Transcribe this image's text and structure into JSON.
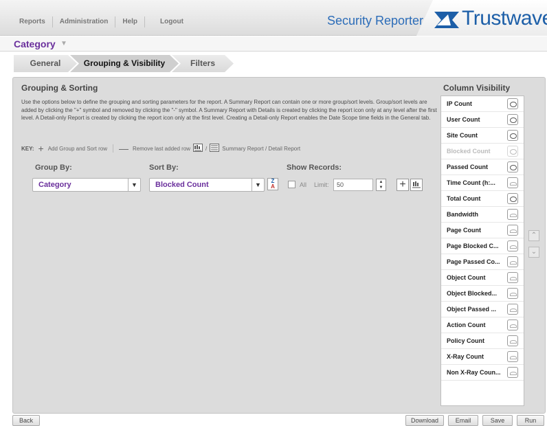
{
  "header": {
    "nav": [
      "Reports",
      "Administration",
      "Help",
      "Logout"
    ],
    "app_title": "Security Reporter",
    "brand": "Trustwave",
    "brand_mark": "®"
  },
  "category": {
    "title": "Category"
  },
  "tabs": [
    {
      "label": "General",
      "active": false
    },
    {
      "label": "Grouping & Visibility",
      "active": true
    },
    {
      "label": "Filters",
      "active": false
    }
  ],
  "grouping": {
    "title": "Grouping & Sorting",
    "description": "Use the options below to define the grouping and sorting parameters for the report. A Summary Report can contain one or more group/sort levels. Group/sort levels are added by clicking the \"+\" symbol and removed by clicking the \"-\" symbol. A Summary Report with Details is created by clicking the report icon only at any level after the first level. A Detail-only Report is created by clicking the report icon only at the first level. Creating a Detail-only Report enables the Date Scope time fields in the General tab.",
    "key_label": "KEY:",
    "key_add": "Add Group and Sort row",
    "key_remove": "Remove last added row",
    "key_slash": "/",
    "key_report": "Summary Report / Detail Report",
    "group_by_label": "Group By:",
    "sort_by_label": "Sort By:",
    "show_records_label": "Show Records:",
    "group_by_value": "Category",
    "sort_by_value": "Blocked Count",
    "all_label": "All",
    "limit_label": "Limit:",
    "limit_value": "50"
  },
  "column_visibility": {
    "title": "Column Visibility",
    "items": [
      {
        "name": "IP Count",
        "visible": true,
        "disabled": false
      },
      {
        "name": "User Count",
        "visible": true,
        "disabled": false
      },
      {
        "name": "Site Count",
        "visible": true,
        "disabled": false
      },
      {
        "name": "Blocked Count",
        "visible": true,
        "disabled": true
      },
      {
        "name": "Passed Count",
        "visible": true,
        "disabled": false
      },
      {
        "name": "Time Count (h:...",
        "visible": false,
        "disabled": false
      },
      {
        "name": "Total Count",
        "visible": true,
        "disabled": false
      },
      {
        "name": "Bandwidth",
        "visible": false,
        "disabled": false
      },
      {
        "name": "Page Count",
        "visible": false,
        "disabled": false
      },
      {
        "name": "Page Blocked C...",
        "visible": false,
        "disabled": false
      },
      {
        "name": "Page Passed Co...",
        "visible": false,
        "disabled": false
      },
      {
        "name": "Object Count",
        "visible": false,
        "disabled": false
      },
      {
        "name": "Object Blocked...",
        "visible": false,
        "disabled": false
      },
      {
        "name": "Object Passed ...",
        "visible": false,
        "disabled": false
      },
      {
        "name": "Action Count",
        "visible": false,
        "disabled": false
      },
      {
        "name": "Policy Count",
        "visible": false,
        "disabled": false
      },
      {
        "name": "X-Ray Count",
        "visible": false,
        "disabled": false
      },
      {
        "name": "Non X-Ray Coun...",
        "visible": false,
        "disabled": false
      }
    ]
  },
  "footer": {
    "back": "Back",
    "download": "Download",
    "email": "Email",
    "save": "Save",
    "run": "Run"
  },
  "colors": {
    "accent_purple": "#6a2f9c",
    "brand_blue": "#1d5fa8",
    "title_blue": "#2b6cb8"
  }
}
